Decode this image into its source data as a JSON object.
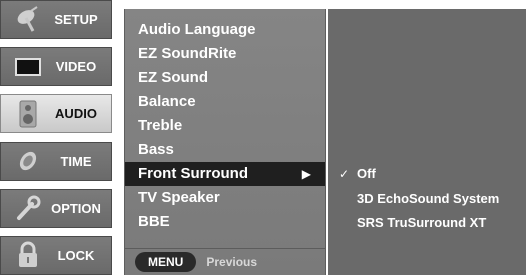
{
  "sidebar": {
    "items": [
      {
        "label": "SETUP",
        "icon": "satellite-icon",
        "active": false
      },
      {
        "label": "VIDEO",
        "icon": "screen-icon",
        "active": false
      },
      {
        "label": "AUDIO",
        "icon": "speaker-icon",
        "active": true
      },
      {
        "label": "TIME",
        "icon": "clock-icon",
        "active": false
      },
      {
        "label": "OPTION",
        "icon": "wrench-icon",
        "active": false
      },
      {
        "label": "LOCK",
        "icon": "lock-icon",
        "active": false
      }
    ]
  },
  "menu": {
    "items": [
      {
        "label": "Audio Language"
      },
      {
        "label": "EZ SoundRite"
      },
      {
        "label": "EZ Sound"
      },
      {
        "label": "Balance"
      },
      {
        "label": "Treble"
      },
      {
        "label": "Bass"
      },
      {
        "label": "Front Surround",
        "selected": true,
        "arrow": "▶"
      },
      {
        "label": "TV Speaker"
      },
      {
        "label": "BBE"
      }
    ],
    "footer": {
      "key_label": "MENU",
      "key_desc": "Previous"
    }
  },
  "submenu": {
    "items": [
      {
        "label": "Off",
        "checked": true,
        "check_mark": "✓"
      },
      {
        "label": "3D EchoSound System",
        "checked": false
      },
      {
        "label": "SRS TruSurround XT",
        "checked": false
      }
    ]
  },
  "colors": {
    "sidebar_item": "#6f6f6f",
    "sidebar_active": "#d9d9d9",
    "menu_panel": "#808080",
    "menu_selected": "#1f1f1f",
    "sub_panel": "#6a6a6a"
  }
}
